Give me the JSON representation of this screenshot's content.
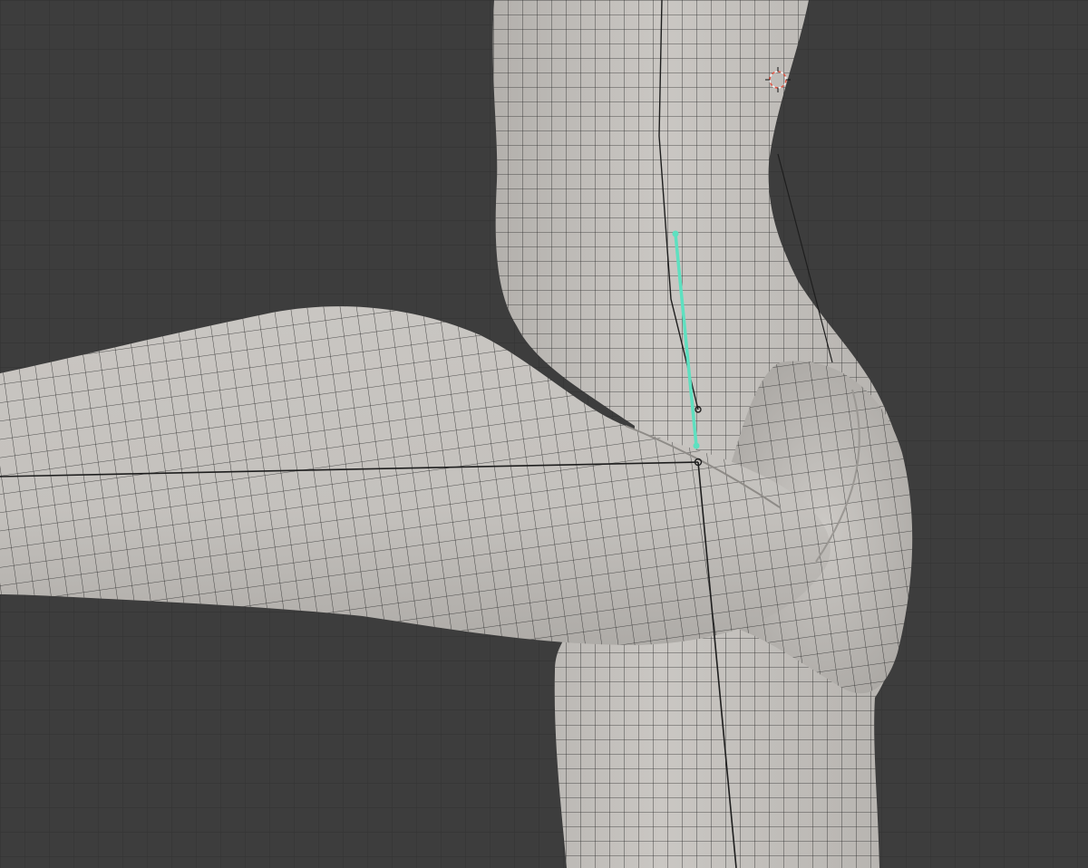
{
  "viewport": {
    "background_color": "#3d3d3d",
    "grid_color": "#333333",
    "mesh_fill_color": "#c7c4c0",
    "mesh_shade_color": "#a9a6a2",
    "wire_color": "#2a2a2a",
    "selected_bone_color": "#5ee0c0",
    "cursor_color": "#e05a4a"
  },
  "objects": {
    "mesh": {
      "icon": "mesh-object-icon",
      "mode": "edit-wireframe"
    },
    "armature": {
      "icon": "armature-bone-icon"
    },
    "selected_bone": {
      "icon": "bone-icon",
      "state": "selected"
    },
    "cursor": {
      "icon": "3d-cursor-icon"
    }
  }
}
